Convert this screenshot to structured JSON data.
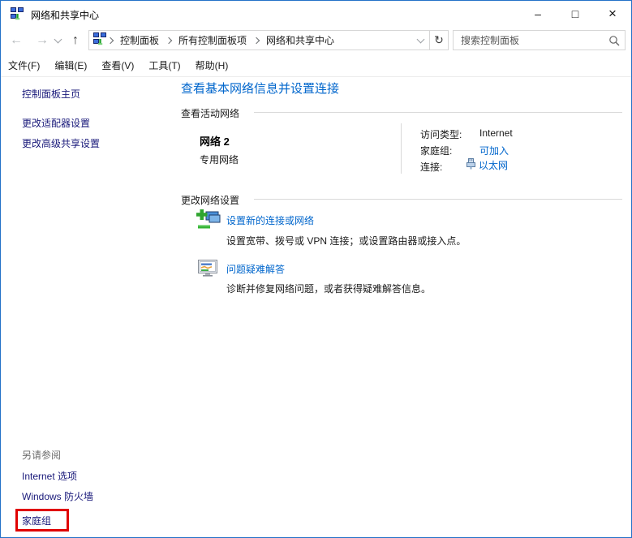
{
  "colors": {
    "link": "#0066CC",
    "sidebar_link": "#19197A",
    "highlight": "#E00000",
    "window_border": "#2472C8",
    "rule": "#D9D9D9"
  },
  "window": {
    "title": "网络和共享中心",
    "controls": {
      "minimize": "–",
      "maximize": "□",
      "close": "×"
    }
  },
  "toolbar": {
    "glyphs": {
      "back": "←",
      "forward": "→",
      "up": "↑",
      "refresh": "↻"
    },
    "breadcrumb": [
      "控制面板",
      "所有控制面板项",
      "网络和共享中心"
    ],
    "search_placeholder": "搜索控制面板"
  },
  "menu": {
    "items": [
      "文件(F)",
      "编辑(E)",
      "查看(V)",
      "工具(T)",
      "帮助(H)"
    ]
  },
  "sidebar": {
    "home": "控制面板主页",
    "items": [
      "更改适配器设置",
      "更改高级共享设置"
    ]
  },
  "main": {
    "title": "查看基本网络信息并设置连接",
    "active_networks": {
      "heading": "查看活动网络",
      "network_name": "网络 2",
      "network_profile": "专用网络",
      "details": [
        {
          "label": "访问类型:",
          "value": "Internet"
        },
        {
          "label": "家庭组:",
          "value": "可加入"
        },
        {
          "label": "连接:",
          "value": "以太网"
        }
      ]
    },
    "change_settings": {
      "heading": "更改网络设置",
      "tasks": [
        {
          "title": "设置新的连接或网络",
          "description": "设置宽带、拨号或 VPN 连接；或设置路由器或接入点。"
        },
        {
          "title": "问题疑难解答",
          "description": "诊断并修复网络问题，或者获得疑难解答信息。"
        }
      ]
    }
  },
  "see_also": {
    "heading": "另请参阅",
    "links": [
      "Internet 选项",
      "Windows 防火墙",
      "家庭组"
    ]
  }
}
